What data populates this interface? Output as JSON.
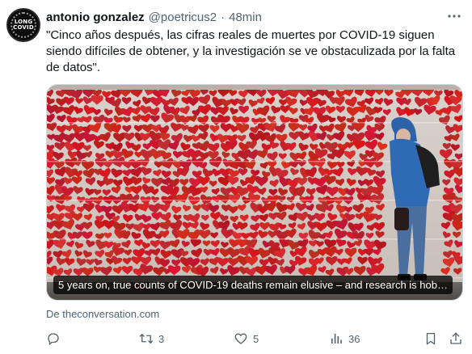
{
  "author": {
    "name": "antonio gonzalez",
    "handle": "@poetricus2",
    "separator": "·",
    "time": "48min",
    "avatar_text_line1": "LONG",
    "avatar_text_line2": "COVID"
  },
  "tweet": {
    "text": "\"Cinco años después, las cifras reales de muertes por COVID-19 siguen siendo difíciles de obtener, y la investigación se ve obstaculizada por la falta de datos\"."
  },
  "card": {
    "title": "5 years on, true counts of COVID-19 deaths remain elusive – and research is hob…",
    "source": "De theconversation.com"
  },
  "actions": {
    "reply_count": "",
    "retweet_count": "3",
    "like_count": "5",
    "views_count": "36"
  },
  "icons": {
    "more": "more-dots-icon",
    "reply": "reply-icon",
    "retweet": "retweet-icon",
    "like": "heart-icon",
    "views": "views-icon",
    "bookmark": "bookmark-icon",
    "share": "share-icon"
  },
  "colors": {
    "text": "#0f1419",
    "secondary": "#536471",
    "heart_red": "#d42a2a"
  }
}
